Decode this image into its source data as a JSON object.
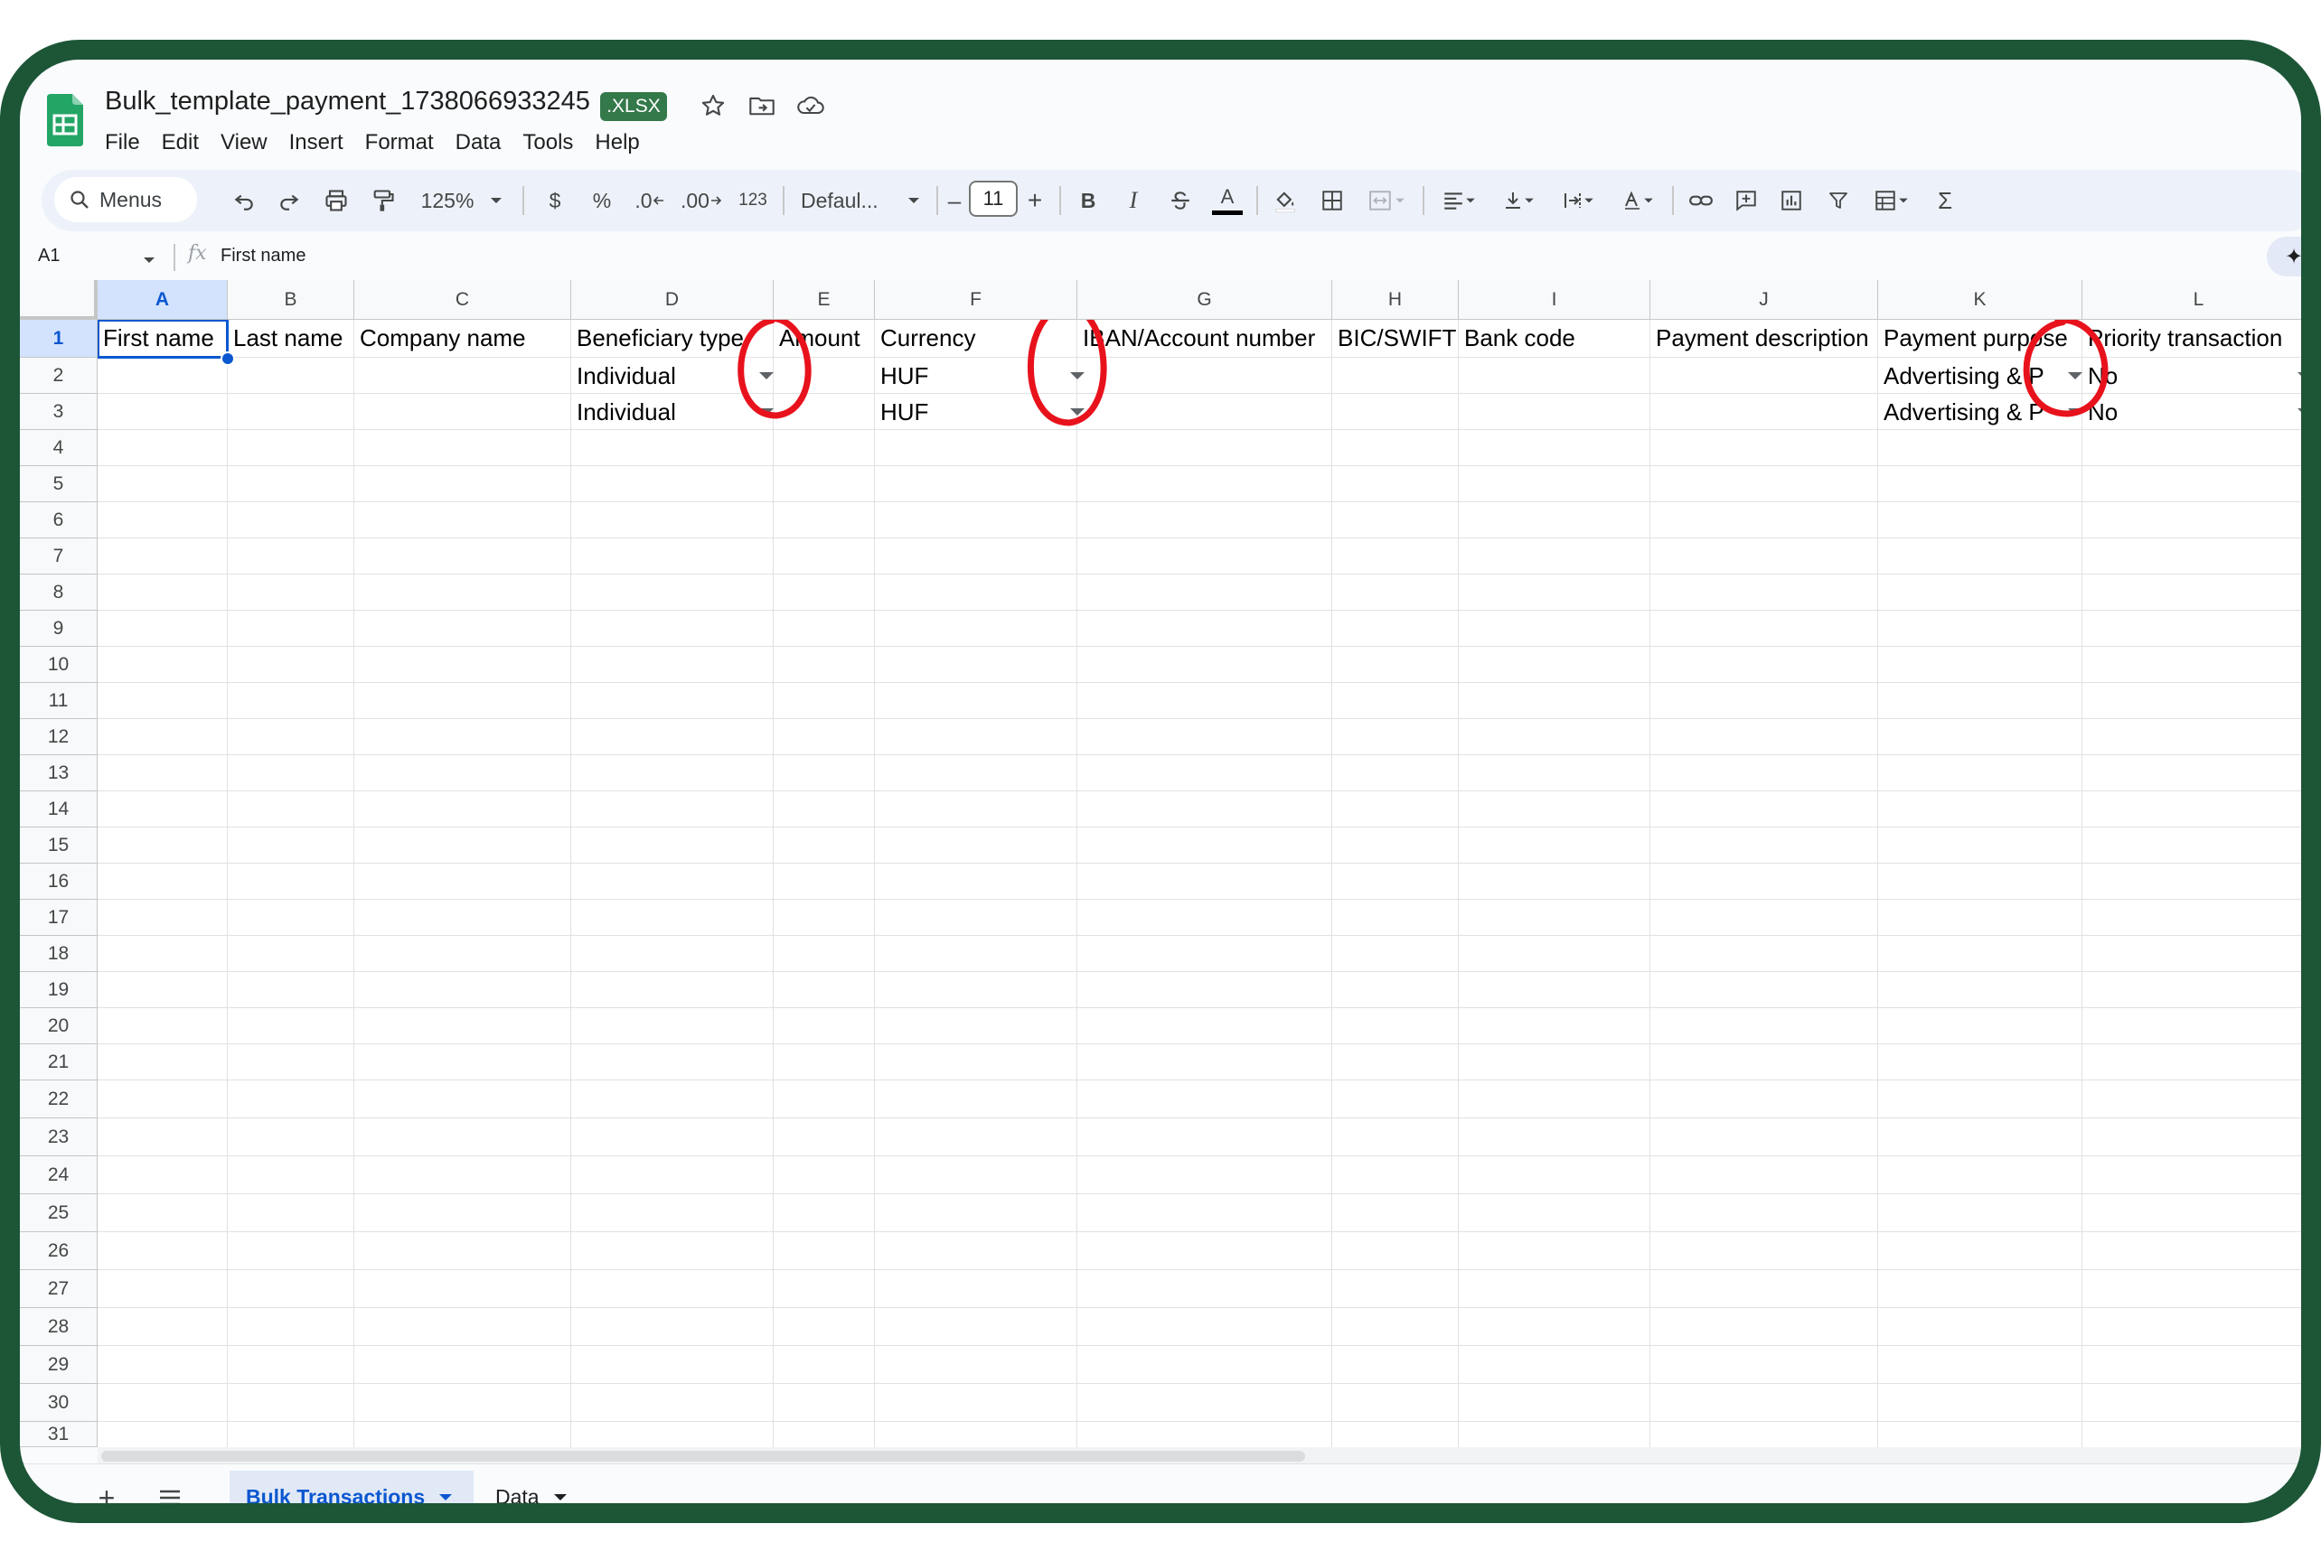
{
  "document": {
    "title": "Bulk_template_payment_1738066933245",
    "format_badge": ".XLSX"
  },
  "menubar": [
    "File",
    "Edit",
    "View",
    "Insert",
    "Format",
    "Data",
    "Tools",
    "Help"
  ],
  "toolbar": {
    "search_label": "Menus",
    "zoom": "125%",
    "currency": "$",
    "percent": "%",
    "decrease_decimal": ".0",
    "increase_decimal": ".00",
    "more_formats": "123",
    "font": "Defaul...",
    "font_size_minus": "–",
    "font_size": "11",
    "font_size_plus": "+",
    "bold": "B",
    "italic": "I",
    "text_color": "A",
    "function": "Σ"
  },
  "formula_bar": {
    "name_box": "A1",
    "fx": "fx",
    "value": "First name"
  },
  "columns": [
    "A",
    "B",
    "C",
    "D",
    "E",
    "F",
    "G",
    "H",
    "I",
    "J",
    "K",
    "L"
  ],
  "rows": [
    "1",
    "2",
    "3",
    "4",
    "5",
    "6",
    "7",
    "8",
    "9",
    "10",
    "11",
    "12",
    "13",
    "14",
    "15",
    "16",
    "17",
    "18",
    "19",
    "20",
    "21",
    "22",
    "23",
    "24",
    "25",
    "26",
    "27",
    "28",
    "29",
    "30",
    "31"
  ],
  "header_row": [
    "First name",
    "Last name",
    "Company name",
    "Beneficiary type",
    "Amount",
    "Currency",
    "IBAN/Account number",
    "BIC/SWIFT",
    "Bank code",
    "Payment description",
    "Payment purpose",
    "Priority transaction"
  ],
  "data_rows": [
    {
      "beneficiary_type": "Individual",
      "currency": "HUF",
      "payment_purpose": "Advertising & P",
      "priority": "No"
    },
    {
      "beneficiary_type": "Individual",
      "currency": "HUF",
      "payment_purpose": "Advertising & P",
      "priority": "No"
    }
  ],
  "sheets": {
    "active": "Bulk Transactions",
    "other": "Data"
  },
  "colors": {
    "frame": "#1d5537",
    "selection": "#0b57d0",
    "annotation": "#e8121c",
    "xlsx_badge": "#34794a"
  }
}
